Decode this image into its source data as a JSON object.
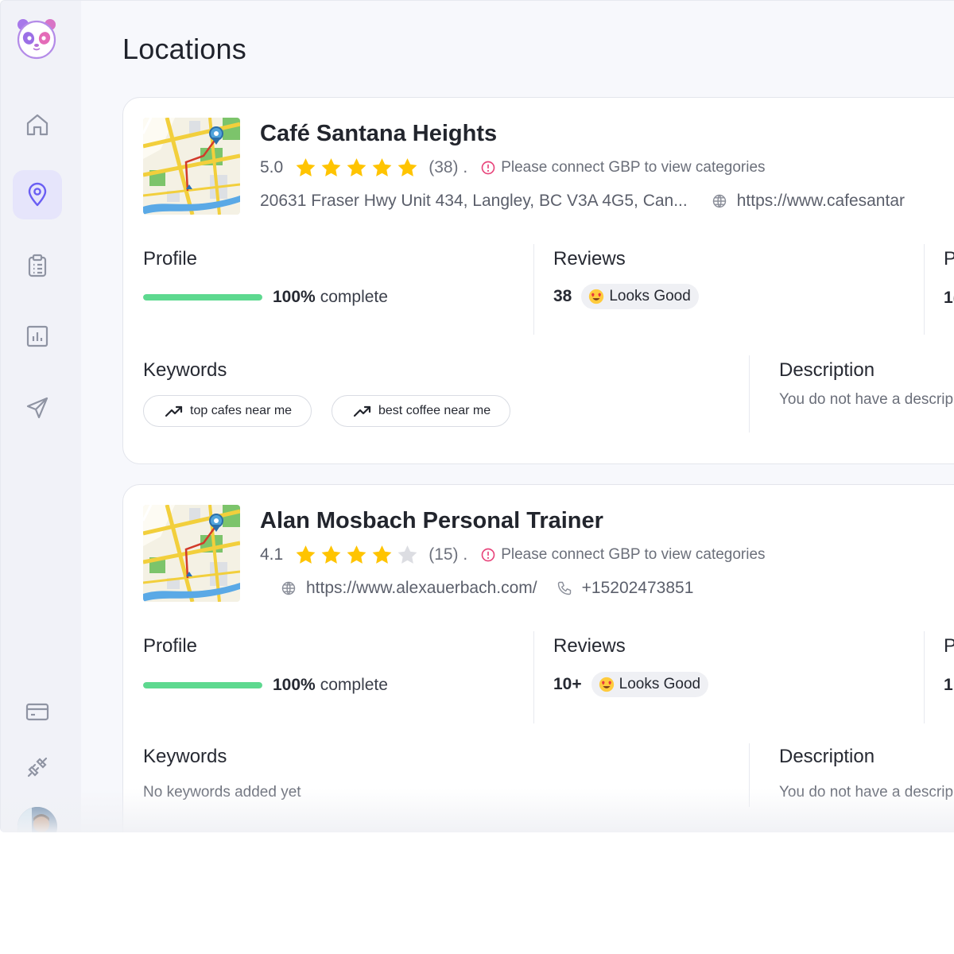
{
  "page": {
    "title": "Locations"
  },
  "colors": {
    "accent": "#6a5ef3",
    "progress": "#5dd98f",
    "star": "#ffc400",
    "warning": "#e8467c"
  },
  "sidebar": {
    "logo": "panda-logo",
    "items": [
      {
        "name": "home",
        "icon": "home-icon",
        "active": false
      },
      {
        "name": "locations",
        "icon": "map-pin-icon",
        "active": true
      },
      {
        "name": "tasks",
        "icon": "clipboard-icon",
        "active": false
      },
      {
        "name": "reports",
        "icon": "bar-chart-icon",
        "active": false
      },
      {
        "name": "send",
        "icon": "send-icon",
        "active": false
      }
    ],
    "bottom": [
      {
        "name": "billing",
        "icon": "credit-card-icon"
      },
      {
        "name": "integrations",
        "icon": "plug-icon"
      }
    ]
  },
  "locations": [
    {
      "name": "Café Santana Heights",
      "rating": "5.0",
      "stars": 5,
      "reviews_paren": "(38) .",
      "category_warning": "Please connect GBP to view categories",
      "address": "20631 Fraser Hwy Unit 434, Langley, BC V3A 4G5, Can...",
      "website": "https://www.cafesantar",
      "profile": {
        "title": "Profile",
        "percent": "100%",
        "percent_value": 100,
        "label": "complete"
      },
      "reviews": {
        "title": "Reviews",
        "count": "38",
        "status": "Looks Good"
      },
      "cut_section": {
        "title": "P",
        "value": "1("
      },
      "keywords": {
        "title": "Keywords",
        "items": [
          "top cafes near me",
          "best coffee near me"
        ]
      },
      "description": {
        "title": "Description",
        "text": "You do not have a descrip"
      }
    },
    {
      "name": "Alan Mosbach Personal Trainer",
      "rating": "4.1",
      "stars": 4,
      "reviews_paren": "(15) .",
      "category_warning": "Please connect GBP to view categories",
      "website": "https://www.alexauerbach.com/",
      "phone": "+15202473851",
      "profile": {
        "title": "Profile",
        "percent": "100%",
        "percent_value": 100,
        "label": "complete"
      },
      "reviews": {
        "title": "Reviews",
        "count": "10+",
        "status": "Looks Good"
      },
      "cut_section": {
        "title": "P",
        "value": "1"
      },
      "keywords": {
        "title": "Keywords",
        "empty": "No keywords added yet"
      },
      "description": {
        "title": "Description",
        "text": "You do not have a descrip"
      }
    }
  ]
}
